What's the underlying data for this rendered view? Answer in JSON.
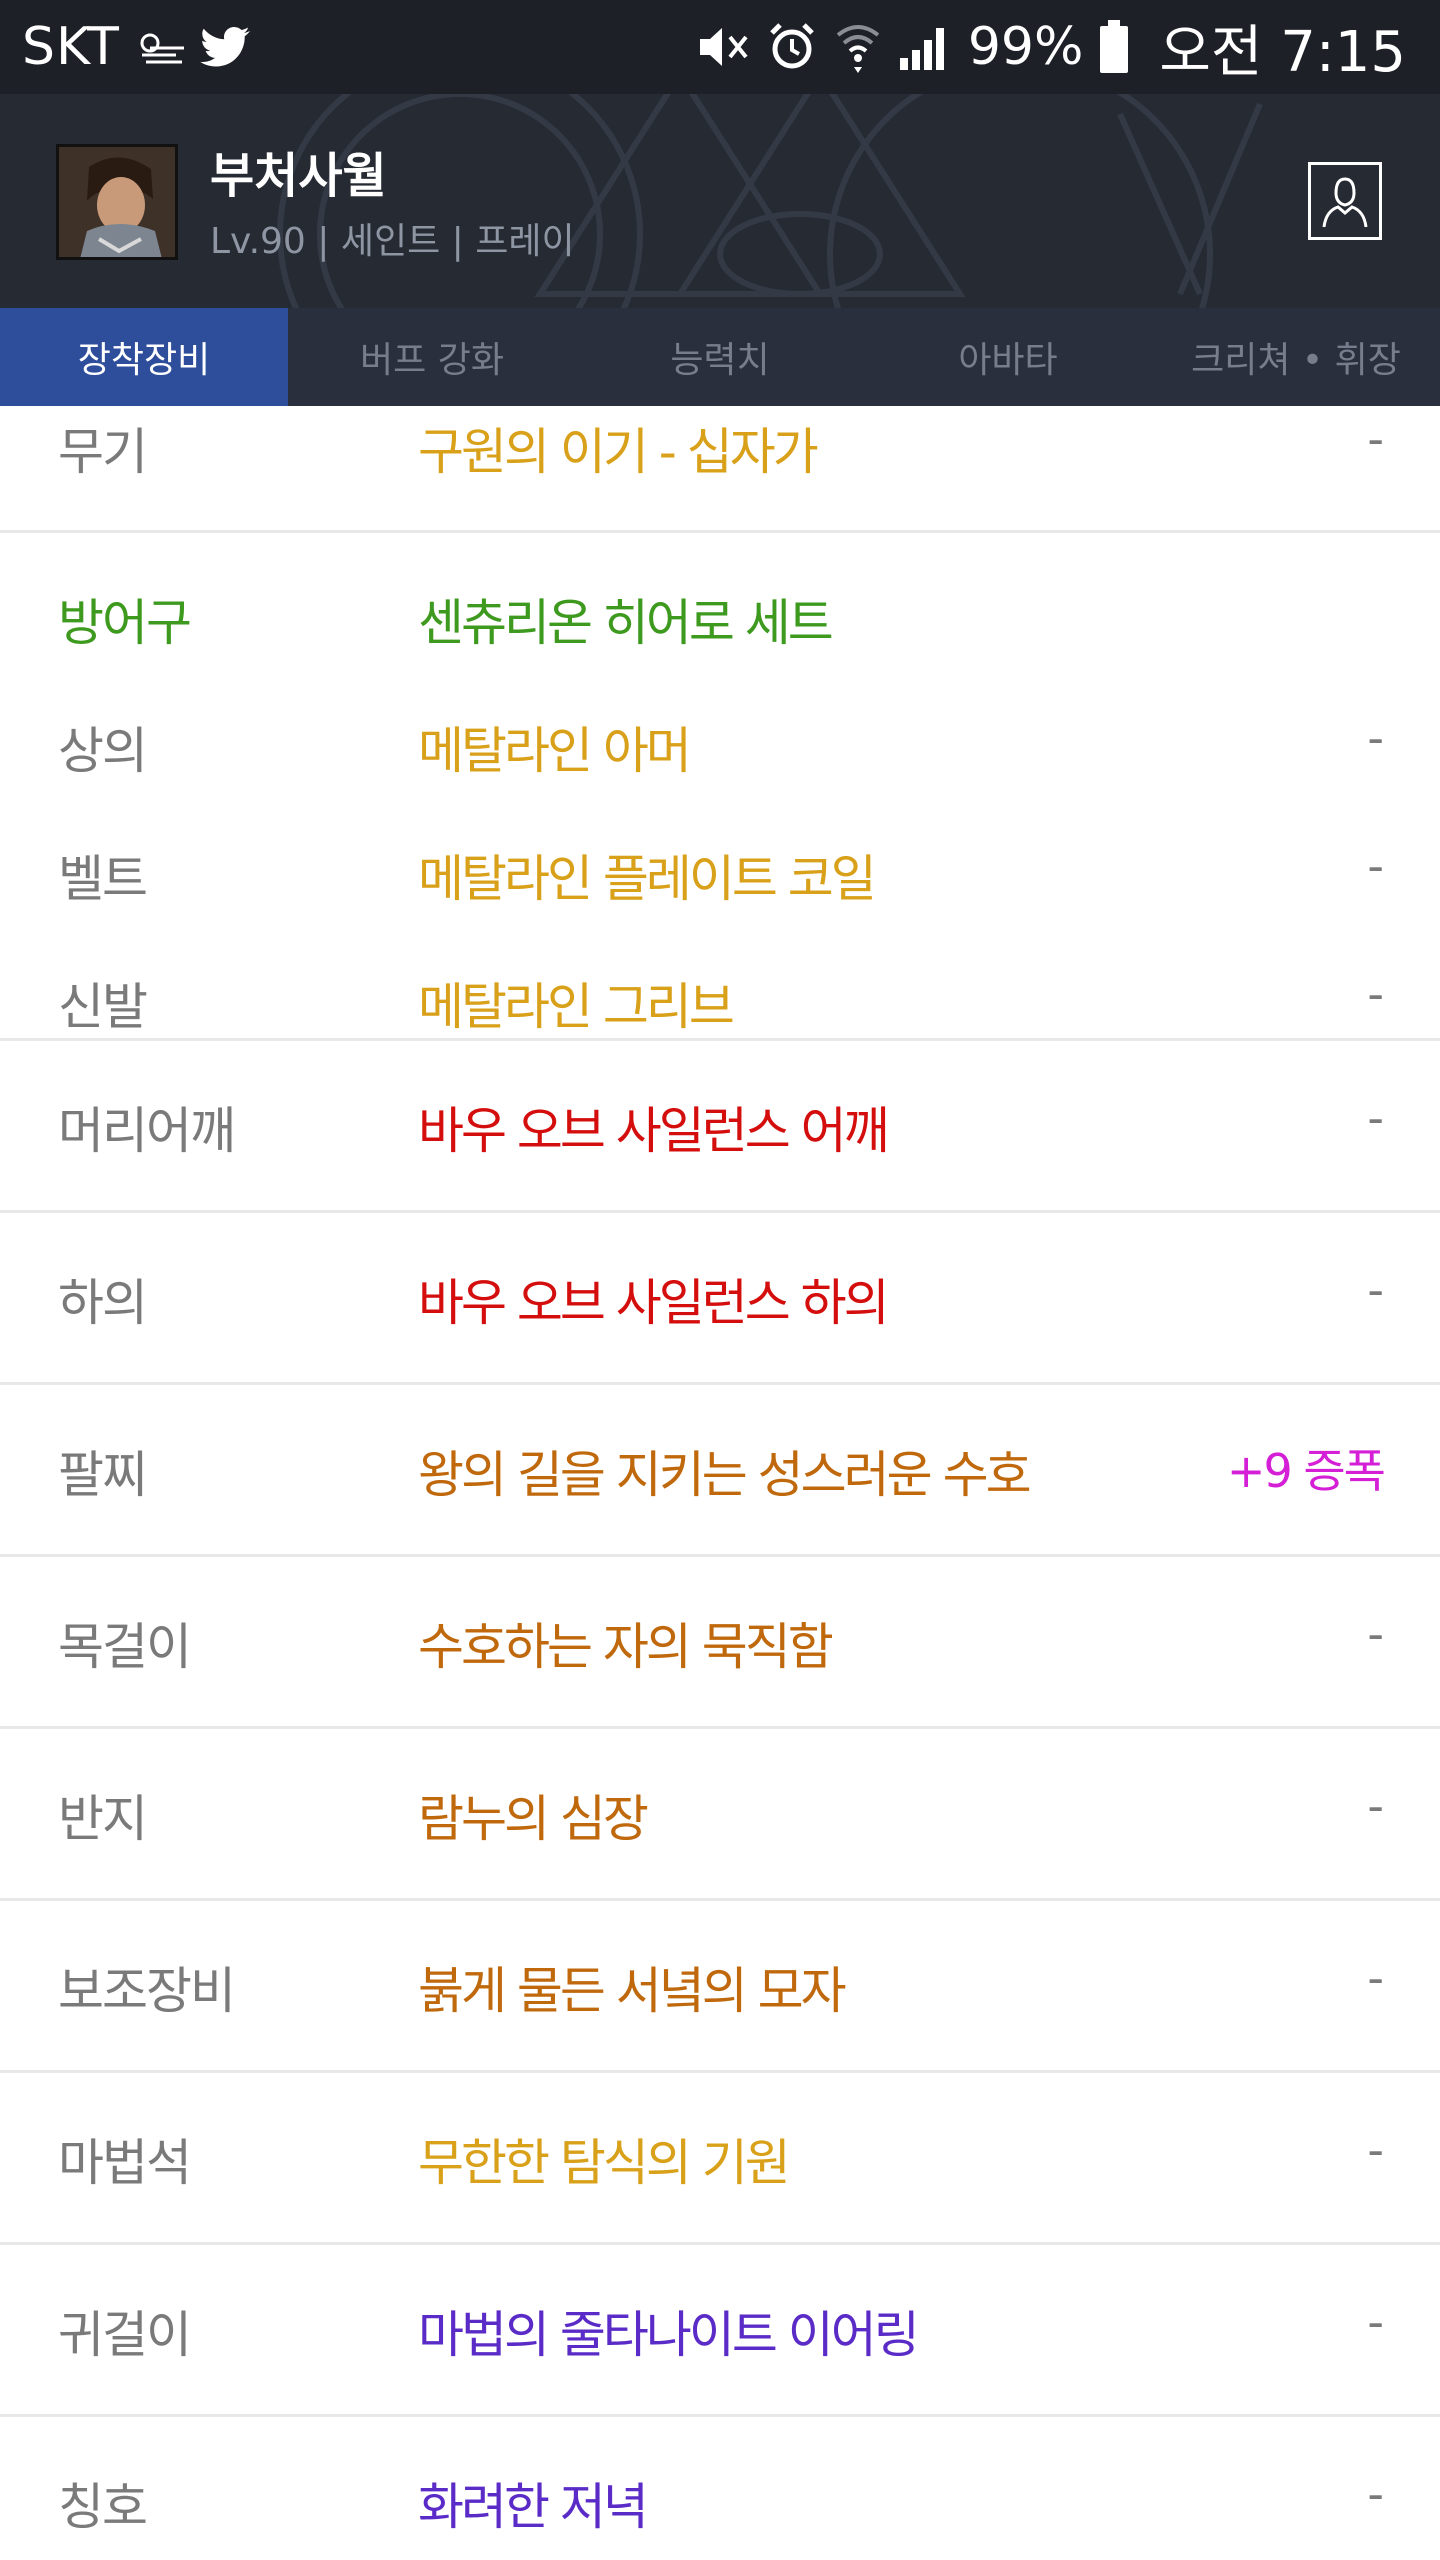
{
  "status_bar": {
    "carrier": "SKT",
    "battery": "99%",
    "time": "오전 7:15"
  },
  "header": {
    "name": "부처사월",
    "subtitle": "Lv.90 | 세인트 | 프레이"
  },
  "tabs": [
    {
      "label": "장착장비",
      "active": true
    },
    {
      "label": "버프 강화",
      "active": false
    },
    {
      "label": "능력치",
      "active": false
    },
    {
      "label": "아바타",
      "active": false
    },
    {
      "label": "크리쳐 • 휘장",
      "active": false
    }
  ],
  "colors": {
    "statusbar": "#1d2027",
    "header": "#262a33",
    "tabbar": "#2a2f3d",
    "tab_active": "#2e4e9c",
    "unique": "#d9a019",
    "set": "#3d9a1f",
    "epic_red": "#d40d0d",
    "legendary": "#c0680c",
    "rare_purple": "#5a2bc7",
    "amplify": "#d41fd6"
  },
  "equipment": {
    "weapon": {
      "label": "무기",
      "item": "구원의 이기 - 십자가",
      "extra": "-"
    },
    "armor_header": {
      "label": "방어구",
      "item": "센츄리온 히어로 세트"
    },
    "top": {
      "label": "상의",
      "item": "메탈라인 아머",
      "extra": "-"
    },
    "belt": {
      "label": "벨트",
      "item": "메탈라인 플레이트 코일",
      "extra": "-"
    },
    "shoes": {
      "label": "신발",
      "item": "메탈라인 그리브",
      "extra": "-"
    },
    "shoulder": {
      "label": "머리어깨",
      "item": "바우 오브 사일런스 어깨",
      "extra": "-"
    },
    "pants": {
      "label": "하의",
      "item": "바우 오브 사일런스 하의",
      "extra": "-"
    },
    "bracelet": {
      "label": "팔찌",
      "item": "왕의 길을 지키는 성스러운 수호",
      "extra": "+9 증폭"
    },
    "necklace": {
      "label": "목걸이",
      "item": "수호하는 자의 묵직함",
      "extra": "-"
    },
    "ring": {
      "label": "반지",
      "item": "람누의 심장",
      "extra": "-"
    },
    "support": {
      "label": "보조장비",
      "item": "붉게 물든 서녘의 모자",
      "extra": "-"
    },
    "magicstone": {
      "label": "마법석",
      "item": "무한한 탐식의 기원",
      "extra": "-"
    },
    "earring": {
      "label": "귀걸이",
      "item": "마법의 줄타나이트 이어링",
      "extra": "-"
    },
    "title": {
      "label": "칭호",
      "item": "화려한 저녁",
      "extra": "-"
    }
  }
}
